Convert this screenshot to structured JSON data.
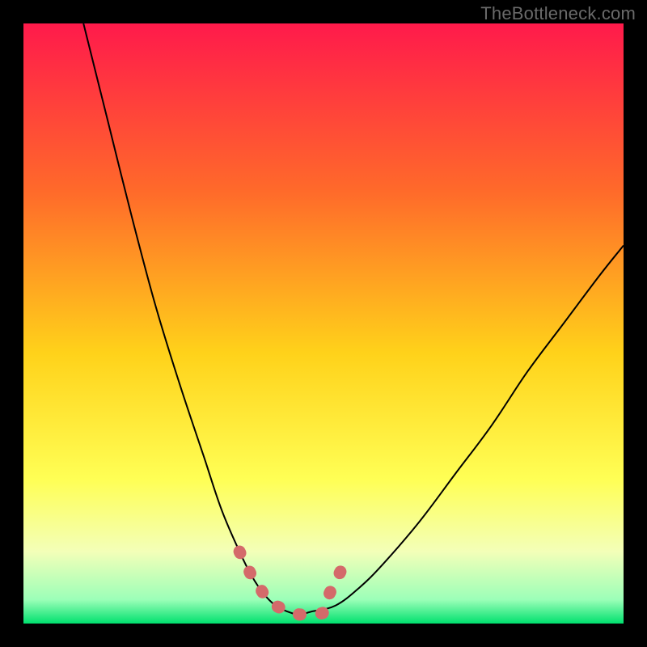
{
  "watermark": "TheBottleneck.com",
  "chart_data": {
    "type": "line",
    "title": "",
    "xlabel": "",
    "ylabel": "",
    "xlim": [
      0,
      100
    ],
    "ylim": [
      0,
      100
    ],
    "grid": false,
    "legend": false,
    "background_gradient": {
      "top": "#ff1a4b",
      "mid_upper": "#ff7a2a",
      "mid": "#ffd21a",
      "mid_lower": "#ffff66",
      "band": "#f6ffcd",
      "bottom": "#00e06e"
    },
    "series": [
      {
        "name": "curve",
        "color": "#000000",
        "x": [
          10,
          14,
          18,
          22,
          26,
          30,
          33,
          36,
          38,
          40,
          42,
          44,
          46,
          48,
          52,
          56,
          60,
          66,
          72,
          78,
          84,
          90,
          96,
          100
        ],
        "y": [
          100,
          84,
          68,
          53,
          40,
          28,
          19,
          12,
          8,
          5,
          3,
          2,
          1.5,
          2,
          3,
          6,
          10,
          17,
          25,
          33,
          42,
          50,
          58,
          63
        ]
      },
      {
        "name": "markers",
        "color": "#d46a6a",
        "style": "thick-dashed",
        "x": [
          36,
          38,
          40,
          42,
          44,
          46,
          47,
          48,
          49,
          50,
          50.5,
          51,
          52,
          53,
          54
        ],
        "y": [
          12,
          8,
          5,
          3,
          2,
          1.5,
          1.5,
          1.5,
          1.5,
          1.8,
          3,
          5,
          7,
          9,
          11
        ]
      }
    ]
  }
}
